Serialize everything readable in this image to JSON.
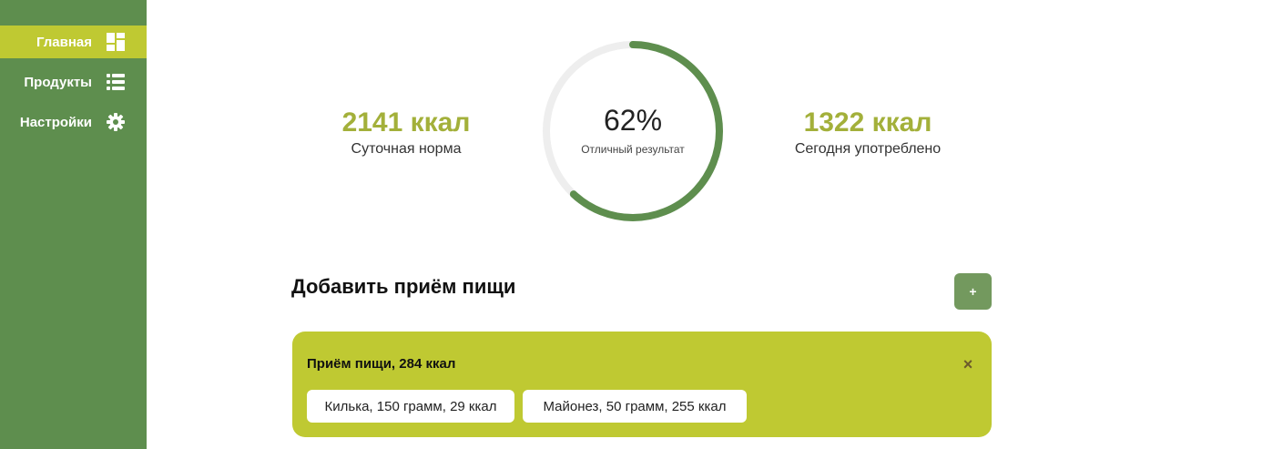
{
  "sidebar": {
    "items": [
      {
        "label": "Главная",
        "icon": "dashboard-icon",
        "active": true
      },
      {
        "label": "Продукты",
        "icon": "list-icon",
        "active": false
      },
      {
        "label": "Настройки",
        "icon": "gear-icon",
        "active": false
      }
    ]
  },
  "stats": {
    "daily_norm": {
      "value": "2141 ккал",
      "label": "Суточная норма"
    },
    "consumed": {
      "value": "1322 ккал",
      "label": "Сегодня употреблено"
    }
  },
  "progress": {
    "percent_text": "62%",
    "fraction": 0.62,
    "caption": "Отличный результат"
  },
  "add_meal": {
    "title": "Добавить приём пищи",
    "button_label": "+"
  },
  "meals": [
    {
      "title": "Приём пищи, 284 ккал",
      "close_label": "×",
      "items": [
        "Килька, 150 грамм, 29 ккал",
        "Майонез, 50 грамм, 255 ккал"
      ]
    }
  ],
  "colors": {
    "sidebar": "#5e8e4e",
    "active": "#bfc932",
    "accent_text": "#a3b03a",
    "ring_track": "#eeeeee",
    "ring_progress": "#5e8e4e",
    "add_button": "#73995e"
  }
}
